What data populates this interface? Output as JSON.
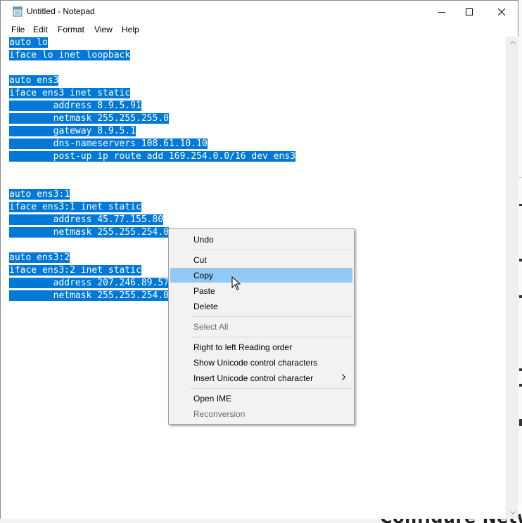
{
  "window": {
    "title": "Untitled - Notepad",
    "controls": {
      "minimize": "minimize",
      "maximize": "maximize",
      "close": "close"
    }
  },
  "menubar": {
    "items": [
      "File",
      "Edit",
      "Format",
      "View",
      "Help"
    ]
  },
  "editor": {
    "lines": [
      "auto lo",
      "iface lo inet loopback",
      "",
      "auto ens3",
      "iface ens3 inet static",
      "        address 8.9.5.91",
      "        netmask 255.255.255.0",
      "        gateway 8.9.5.1",
      "        dns-nameservers 108.61.10.10",
      "        post-up ip route add 169.254.0.0/16 dev ens3",
      "",
      "",
      "auto ens3:1",
      "iface ens3:1 inet static",
      "        address 45.77.155.80",
      "        netmask 255.255.254.0",
      "",
      "auto ens3:2",
      "iface ens3:2 inet static",
      "        address 207.246.89.57",
      "        netmask 255.255.254.0"
    ],
    "selection": "all"
  },
  "context_menu": {
    "items": [
      {
        "label": "Undo",
        "enabled": true
      },
      {
        "label": "Cut",
        "enabled": true
      },
      {
        "label": "Copy",
        "enabled": true,
        "highlighted": true
      },
      {
        "label": "Paste",
        "enabled": true
      },
      {
        "label": "Delete",
        "enabled": true
      },
      {
        "label": "Select All",
        "enabled": false
      },
      {
        "label": "Right to left Reading order",
        "enabled": true
      },
      {
        "label": "Show Unicode control characters",
        "enabled": true
      },
      {
        "label": "Insert Unicode control character",
        "enabled": true,
        "submenu": true
      },
      {
        "label": "Open IME",
        "enabled": true
      },
      {
        "label": "Reconversion",
        "enabled": false
      }
    ]
  },
  "background": {
    "bottom_text": "Configure Network"
  },
  "colors": {
    "selection": "#0078d7",
    "menu_hover": "#91c9f7",
    "disabled_text": "#6d6d6d"
  }
}
